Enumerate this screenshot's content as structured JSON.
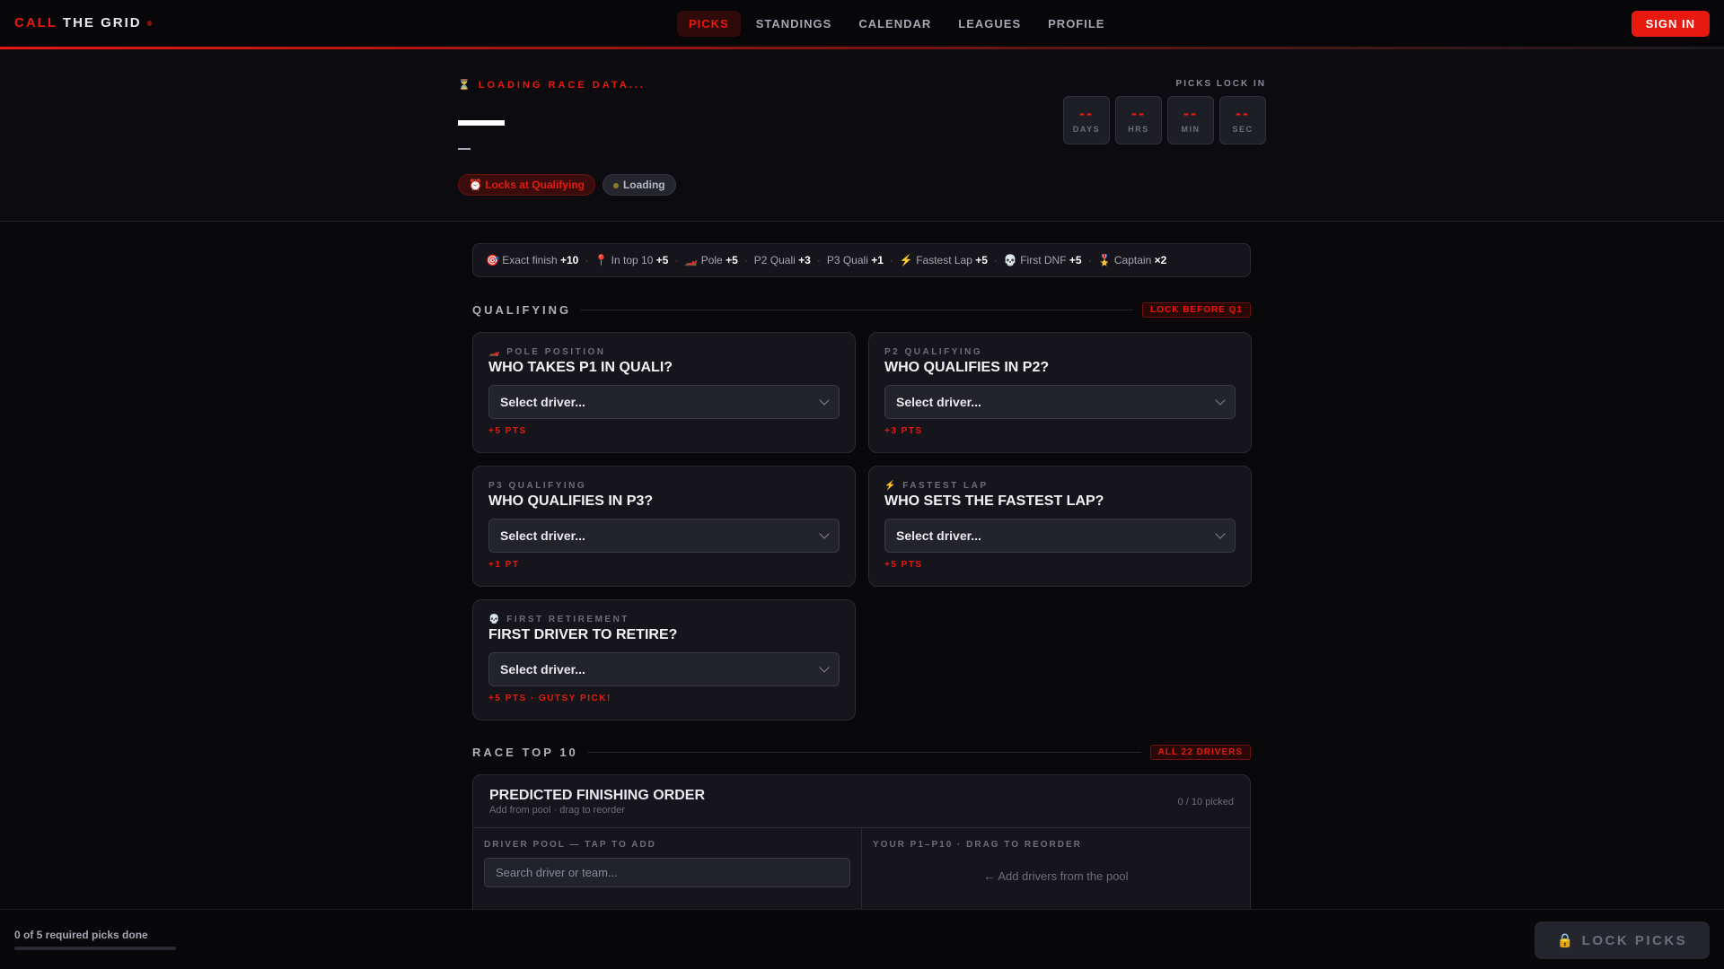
{
  "nav": {
    "logo_a": "CALL",
    "logo_b": "THE GRID",
    "items": [
      "PICKS",
      "STANDINGS",
      "CALENDAR",
      "LEAGUES",
      "PROFILE"
    ],
    "active": "PICKS",
    "signin": "SIGN IN"
  },
  "hero": {
    "status": "⏳ LOADING RACE DATA...",
    "subtitle": "—",
    "pill_lock": "⏰ Locks at Qualifying",
    "pill_status": "Loading",
    "countdown_label": "PICKS LOCK IN",
    "countdown": [
      {
        "v": "--",
        "l": "DAYS"
      },
      {
        "v": "--",
        "l": "HRS"
      },
      {
        "v": "--",
        "l": "MIN"
      },
      {
        "v": "--",
        "l": "SEC"
      }
    ]
  },
  "scoring": [
    {
      "i": "🎯",
      "t": "Exact finish",
      "v": "+10"
    },
    {
      "i": "📍",
      "t": "In top 10",
      "v": "+5"
    },
    {
      "i": "🏎️",
      "t": "Pole",
      "v": "+5"
    },
    {
      "i": "",
      "t": "P2 Quali",
      "v": "+3"
    },
    {
      "i": "",
      "t": "P3 Quali",
      "v": "+1"
    },
    {
      "i": "⚡",
      "t": "Fastest Lap",
      "v": "+5"
    },
    {
      "i": "💀",
      "t": "First DNF",
      "v": "+5"
    },
    {
      "i": "🎖️",
      "t": "Captain",
      "v": "×2"
    }
  ],
  "qualifying": {
    "title": "QUALIFYING",
    "badge": "LOCK BEFORE Q1",
    "cards": [
      {
        "kicker": "🏎️ POLE POSITION",
        "q": "WHO TAKES P1 IN QUALI?",
        "sel": "Select driver...",
        "pts": "+5 PTS"
      },
      {
        "kicker": "P2 QUALIFYING",
        "q": "WHO QUALIFIES IN P2?",
        "sel": "Select driver...",
        "pts": "+3 PTS"
      },
      {
        "kicker": "P3 QUALIFYING",
        "q": "WHO QUALIFIES IN P3?",
        "sel": "Select driver...",
        "pts": "+1 PT"
      },
      {
        "kicker": "⚡ FASTEST LAP",
        "q": "WHO SETS THE FASTEST LAP?",
        "sel": "Select driver...",
        "pts": "+5 PTS"
      },
      {
        "kicker": "💀 FIRST RETIREMENT",
        "q": "FIRST DRIVER TO RETIRE?",
        "sel": "Select driver...",
        "pts": "+5 PTS · GUTSY PICK!"
      }
    ]
  },
  "race": {
    "title": "RACE TOP 10",
    "badge": "ALL 22 DRIVERS",
    "card_title": "PREDICTED FINISHING ORDER",
    "card_sub": "Add from pool · drag to reorder",
    "count": "0 / 10 picked",
    "pool_label": "DRIVER POOL — TAP TO ADD",
    "search_placeholder": "Search driver or team...",
    "order_label": "YOUR P1–P10 · DRAG TO REORDER",
    "empty": "← Add drivers from the pool"
  },
  "bottom": {
    "progress_text": "0 of 5 required picks done",
    "progress": 0,
    "lock": "🔒 LOCK PICKS"
  }
}
